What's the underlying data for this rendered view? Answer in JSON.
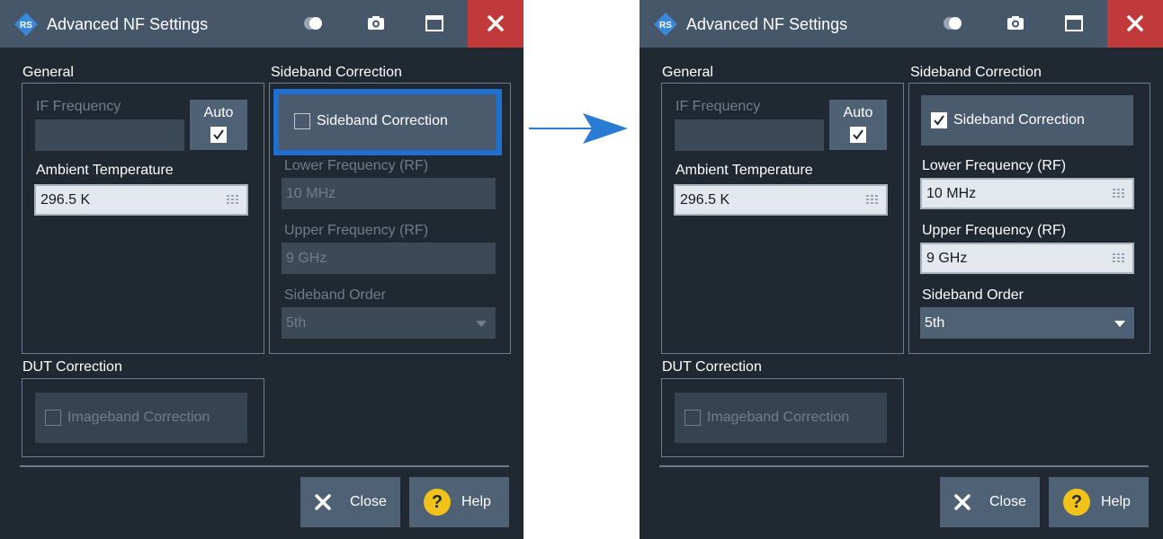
{
  "dialog": {
    "title": "Advanced NF Settings",
    "general_title": "General",
    "if_frequency_label": "IF Frequency",
    "auto_label": "Auto",
    "ambient_temperature_label": "Ambient Temperature",
    "ambient_temperature_value": "296.5 K",
    "sideband_group_title": "Sideband Correction",
    "sideband_checkbox_label": "Sideband Correction",
    "lower_freq_label": "Lower Frequency (RF)",
    "lower_freq_value": "10 MHz",
    "upper_freq_label": "Upper Frequency (RF)",
    "upper_freq_value": "9 GHz",
    "sideband_order_label": "Sideband Order",
    "sideband_order_value": "5th",
    "dut_title": "DUT Correction",
    "imageband_label": "Imageband Correction",
    "close_label": "Close",
    "help_label": "Help",
    "help_symbol": "?"
  },
  "states": {
    "left": {
      "sideband_correction": false,
      "auto": true,
      "imageband_correction": false
    },
    "right": {
      "sideband_correction": true,
      "auto": true,
      "imageband_correction": false
    }
  },
  "icons": [
    "rs-logo-icon",
    "toggle-icon",
    "camera-icon",
    "maximize-icon",
    "close-icon",
    "keypad-icon",
    "checkmark-icon",
    "dropdown-arrow-icon",
    "x-icon",
    "help-icon",
    "arrow-right-icon"
  ],
  "colors": {
    "dialog_bg": "#202832",
    "titlebar_bg": "#46576a",
    "close_window_bg": "#c0393b",
    "focus_highlight": "#1e6fd0",
    "help_icon": "#f0c21a",
    "arrow": "#2a7bd4"
  }
}
